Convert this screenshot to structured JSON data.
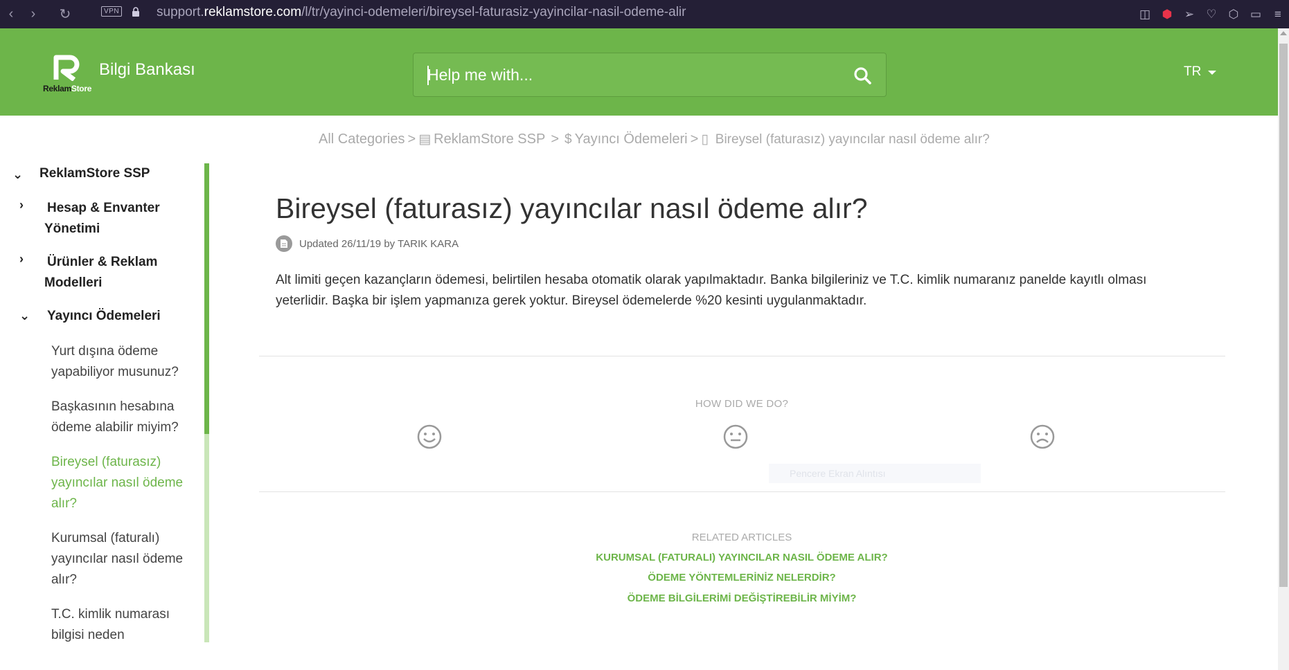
{
  "browser": {
    "url_prefix": "support.",
    "url_domain": "reklamstore.com",
    "url_path": "/l/tr/yayinci-odemeleri/bireysel-faturasiz-yayincilar-nasil-odeme-alir",
    "vpn_label": "VPN"
  },
  "header": {
    "logo_reklam": "Reklam",
    "logo_store": "Store",
    "brand": "Bilgi Bankası",
    "search_placeholder": "Help me with...",
    "lang": "TR"
  },
  "breadcrumb": {
    "all": "All Categories",
    "sep": ">",
    "ssp": "ReklamStore SSP",
    "sep2": ">",
    "payments": "Yayıncı Ödemeleri",
    "current": "Bireysel (faturasız) yayıncılar nasıl ödeme alır?"
  },
  "sidebar": {
    "root": "ReklamStore SSP",
    "cat1_line1": "Hesap & Envanter",
    "cat1_line2": "Yönetimi",
    "cat2_line1": "Ürünler & Reklam",
    "cat2_line2": "Modelleri",
    "cat3": "Yayıncı Ödemeleri",
    "links": [
      {
        "l1": "Yurt dışına ödeme",
        "l2": "yapabiliyor musunuz?",
        "l3": ""
      },
      {
        "l1": "Başkasının hesabına",
        "l2": "ödeme alabilir miyim?",
        "l3": ""
      },
      {
        "l1": "Bireysel (faturasız)",
        "l2": "yayıncılar nasıl ödeme",
        "l3": "alır?"
      },
      {
        "l1": "Kurumsal (faturalı)",
        "l2": "yayıncılar nasıl ödeme",
        "l3": "alır?"
      },
      {
        "l1": "T.C. kimlik numarası",
        "l2": "bilgisi neden",
        "l3": ""
      }
    ]
  },
  "article": {
    "title": "Bireysel (faturasız) yayıncılar nasıl ödeme alır?",
    "updated": "Updated 26/11/19 by TARIK KARA",
    "body_line1": "Alt limiti geçen kazançların ödemesi, belirtilen hesaba otomatik olarak yapılmaktadır. Banka bilgileriniz ve T.C. kimlik numaranız panelde kayıtlı olması",
    "body_line2": "yeterlidir. Başka bir işlem yapmanıza gerek yoktur. Bireysel ödemelerde %20 kesinti uygulanmaktadır."
  },
  "feedback": {
    "title": "HOW DID WE DO?",
    "faint_text": "Pencere Ekran Alıntısı"
  },
  "related": {
    "title": "RELATED ARTICLES",
    "items": [
      "KURUMSAL (FATURALI) YAYINCILAR NASIL ÖDEME ALIR?",
      "ÖDEME YÖNTEMLERİNİZ NELERDİR?",
      "ÖDEME BİLGİLERİMİ DEĞİŞTİREBİLİR MİYİM?"
    ]
  },
  "colors": {
    "brand_green": "#6db54a",
    "chrome_bg": "#241f36"
  }
}
